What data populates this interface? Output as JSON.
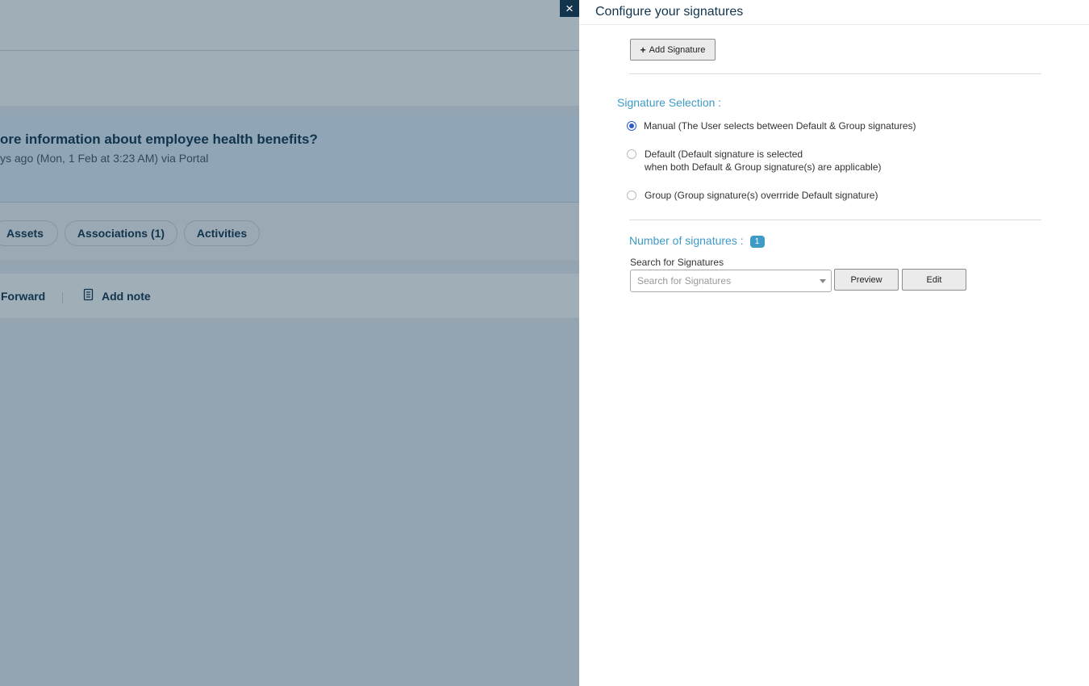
{
  "background": {
    "ticket_subject": "ore information about employee health benefits?",
    "ticket_meta": "ys ago (Mon, 1 Feb at 3:23 AM) via Portal",
    "tabs": [
      {
        "label": "Assets"
      },
      {
        "label": "Associations (1)"
      },
      {
        "label": "Activities"
      }
    ],
    "actions": {
      "forward_label": "Forward",
      "add_note_label": "Add note"
    }
  },
  "panel": {
    "close_icon": "×",
    "title": "Configure your signatures",
    "add_signature_label": "Add Signature",
    "signature_selection_label": "Signature Selection :",
    "radio_options": [
      {
        "line1": "Manual (The User selects between Default & Group signatures)",
        "line2": "",
        "checked": true
      },
      {
        "line1": "Default (Default signature is selected",
        "line2": "when both Default & Group signature(s) are applicable)",
        "checked": false
      },
      {
        "line1": "Group (Group signature(s) overrride Default signature)",
        "line2": "",
        "checked": false
      }
    ],
    "number_of_signatures_label": "Number of signatures :",
    "number_of_signatures_count": "1",
    "search_label": "Search for Signatures",
    "search_placeholder": "Search for Signatures",
    "preview_label": "Preview",
    "edit_label": "Edit"
  },
  "colors": {
    "accent_label": "#3d9bc6",
    "dark_navy": "#12344d",
    "radio_selected": "#2c5cc5"
  }
}
